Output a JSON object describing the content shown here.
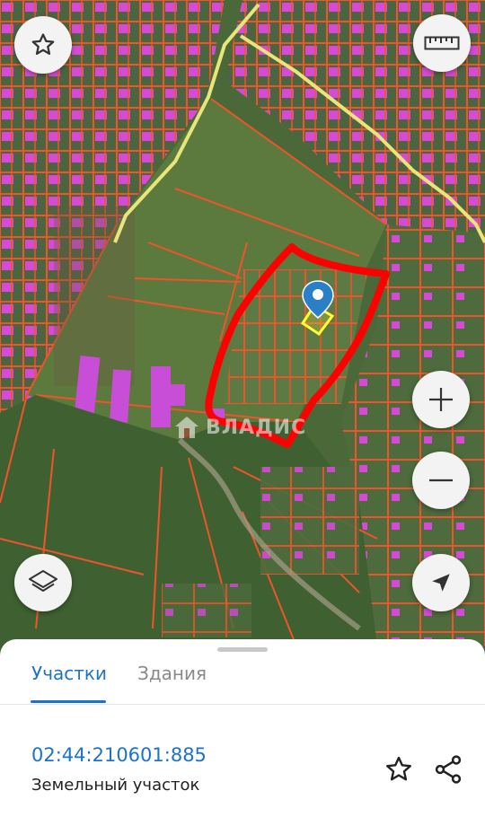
{
  "map": {
    "watermark_text": "ВЛАДИС",
    "highlight_color": "#ff0000",
    "parcel_border_color": "#f0542a",
    "building_color": "#d64ad6",
    "selected_plot_color": "#ffff33",
    "marker_color": "#2a7fc7",
    "boundary_line_color": "#e6e67a"
  },
  "controls": {
    "favorite_icon": "star-outline-icon",
    "ruler_icon": "ruler-icon",
    "zoom_in_icon": "plus-icon",
    "zoom_out_icon": "minus-icon",
    "layers_icon": "layers-icon",
    "locate_icon": "navigation-arrow-icon"
  },
  "sheet": {
    "tabs": [
      {
        "label": "Участки",
        "active": true
      },
      {
        "label": "Здания",
        "active": false
      }
    ],
    "cadastral_number": "02:44:210601:885",
    "plot_type": "Земельный участок",
    "actions": [
      "star-outline-icon",
      "share-icon"
    ],
    "accent_color": "#1d73c8"
  }
}
